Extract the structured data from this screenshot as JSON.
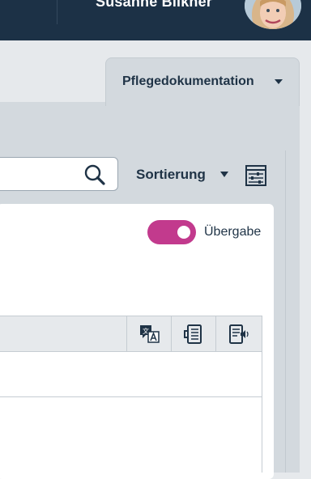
{
  "header": {
    "user_name": "Susanne Bilkner"
  },
  "tabs": [
    {
      "label": "Pflegedokumentation",
      "active": true
    }
  ],
  "toolbar": {
    "search_value": "",
    "sort_label": "Sortierung"
  },
  "handover": {
    "label": "Übergabe",
    "enabled": true,
    "accent_color": "#c23a8d"
  },
  "table": {
    "header_actions": [
      {
        "icon": "translate-icon"
      },
      {
        "icon": "document-icon"
      },
      {
        "icon": "read-aloud-icon"
      }
    ],
    "rows": [
      {
        "cells": []
      },
      {
        "cells": []
      }
    ]
  },
  "colors": {
    "topbar": "#1c3146",
    "text": "#1f3346",
    "panel": "#d3d9de",
    "background": "#e6e9ec"
  }
}
